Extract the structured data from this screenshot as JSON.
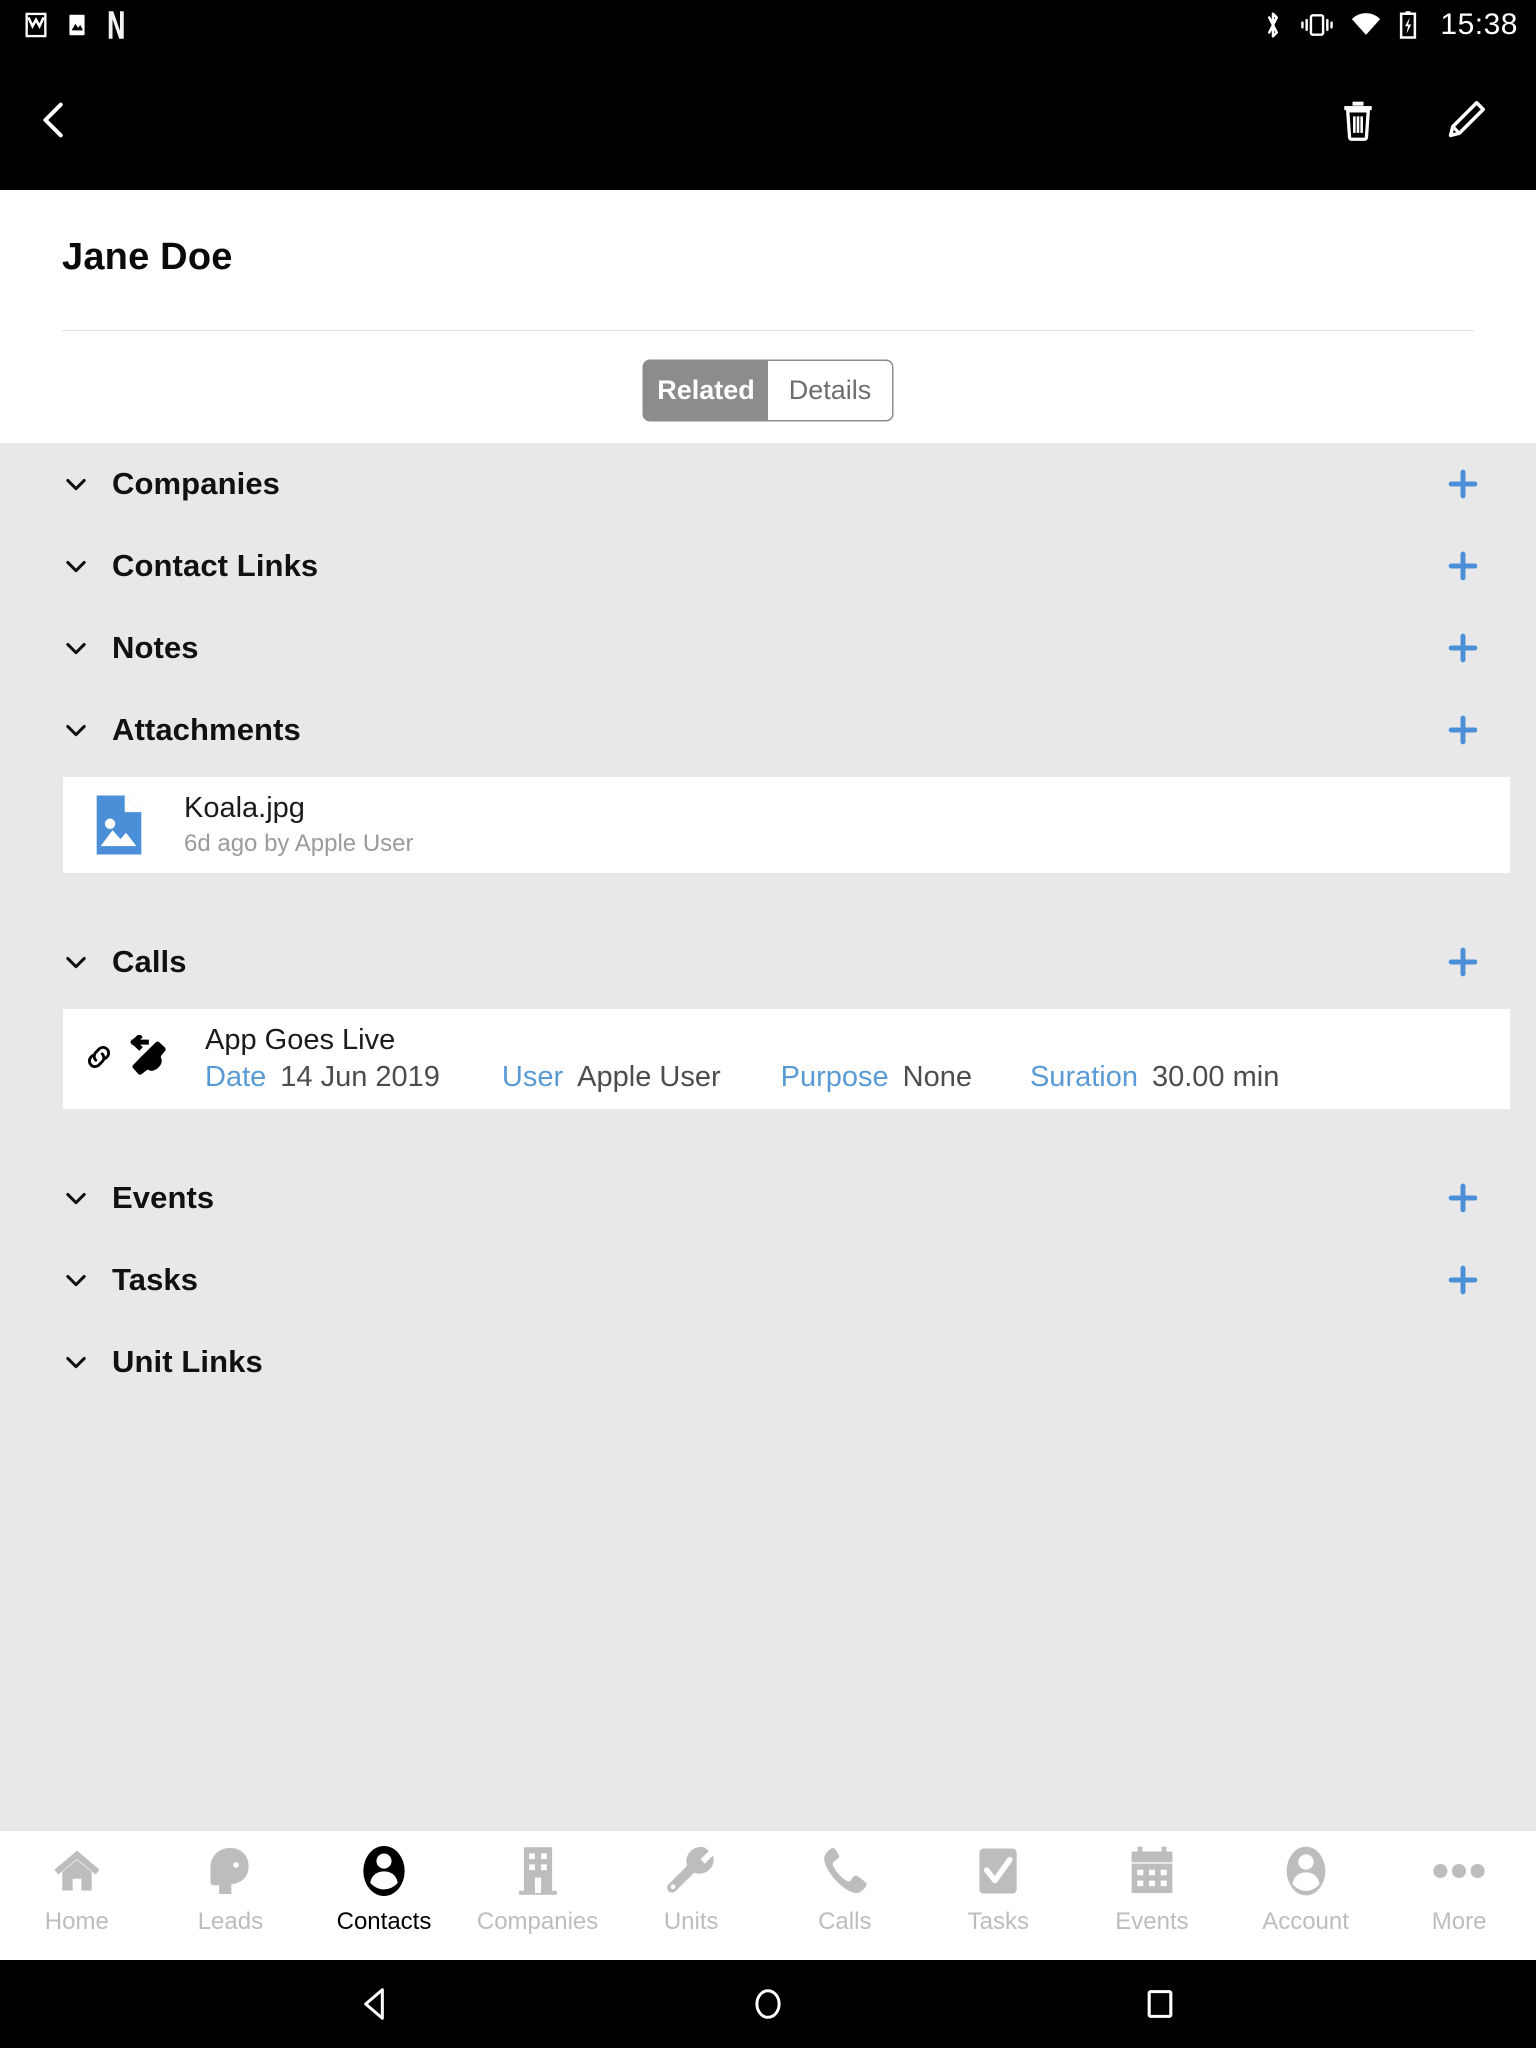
{
  "status_bar": {
    "time": "15:38",
    "left_icons": [
      "gmail-icon",
      "photos-icon",
      "netflix-icon"
    ],
    "right_icons": [
      "bluetooth-icon",
      "vibrate-icon",
      "wifi-icon",
      "battery-charging-icon"
    ]
  },
  "app_bar": {
    "back_label": "back-chevron-icon",
    "delete_label": "delete-icon",
    "edit_label": "edit-icon"
  },
  "header": {
    "title": "Jane Doe",
    "tabs": [
      {
        "label": "Related",
        "active": true
      },
      {
        "label": "Details",
        "active": false
      }
    ]
  },
  "colors": {
    "accent_blue": "#5b9bd5",
    "plus_blue": "#4a8fd8",
    "background": "#e8e8e8",
    "card": "#ffffff",
    "segment_active": "#8c8c8c",
    "appbar": "#000000",
    "muted_text": "#9b9b9b"
  },
  "sections": [
    {
      "label": "Companies",
      "expanded": true,
      "has_add": true,
      "items": []
    },
    {
      "label": "Contact Links",
      "expanded": true,
      "has_add": true,
      "items": []
    },
    {
      "label": "Notes",
      "expanded": true,
      "has_add": true,
      "items": []
    },
    {
      "label": "Attachments",
      "expanded": true,
      "has_add": true,
      "items": [
        "attachment"
      ]
    },
    {
      "label": "Calls",
      "expanded": true,
      "has_add": true,
      "items": [
        "call"
      ]
    },
    {
      "label": "Events",
      "expanded": true,
      "has_add": true,
      "items": []
    },
    {
      "label": "Tasks",
      "expanded": true,
      "has_add": true,
      "items": []
    },
    {
      "label": "Unit Links",
      "expanded": true,
      "has_add": false,
      "items": []
    }
  ],
  "attachment": {
    "name": "Koala.jpg",
    "subtitle": "6d ago by Apple User",
    "icon": "image-file-icon"
  },
  "call": {
    "title": "App Goes Live",
    "icons": [
      "link-icon",
      "incoming-call-icon"
    ],
    "fields": [
      {
        "label": "Date",
        "value": "14 Jun 2019"
      },
      {
        "label": "User",
        "value": "Apple User"
      },
      {
        "label": "Purpose",
        "value": "None"
      },
      {
        "label": "Suration",
        "value": "30.00 min"
      }
    ]
  },
  "bottom_nav": [
    {
      "label": "Home",
      "icon": "home-icon",
      "active": false
    },
    {
      "label": "Leads",
      "icon": "lead-head-icon",
      "active": false
    },
    {
      "label": "Contacts",
      "icon": "contact-icon",
      "active": true
    },
    {
      "label": "Companies",
      "icon": "building-icon",
      "active": false
    },
    {
      "label": "Units",
      "icon": "wrench-icon",
      "active": false
    },
    {
      "label": "Calls",
      "icon": "phone-icon",
      "active": false
    },
    {
      "label": "Tasks",
      "icon": "checkbox-icon",
      "active": false
    },
    {
      "label": "Events",
      "icon": "calendar-icon",
      "active": false
    },
    {
      "label": "Account",
      "icon": "account-icon",
      "active": false
    },
    {
      "label": "More",
      "icon": "ellipsis-icon",
      "active": false
    }
  ],
  "system_nav": {
    "back": "system-back-icon",
    "home": "system-home-icon",
    "recents": "system-recents-icon"
  }
}
